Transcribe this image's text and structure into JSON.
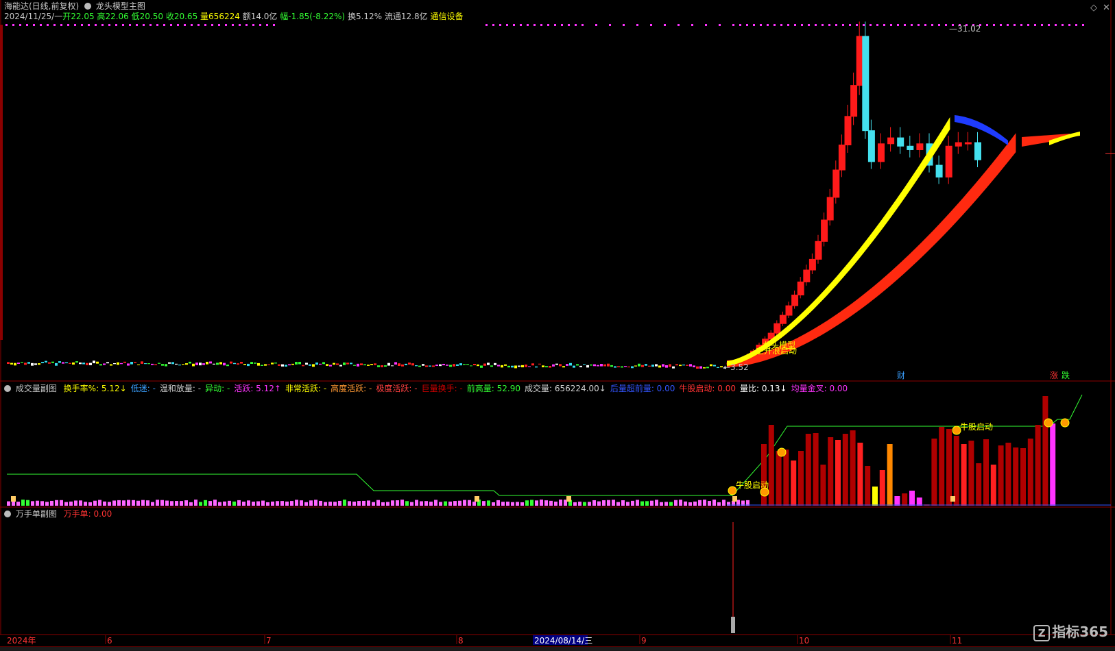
{
  "header": {
    "title": "海能达(日线,前复权)",
    "indicator": "龙头模型主图"
  },
  "info": {
    "date": "2024/11/25/一",
    "open_label": "开",
    "open": "22.05",
    "high_label": "高",
    "high": "22.06",
    "low_label": "低",
    "low": "20.50",
    "close_label": "收",
    "close": "20.65",
    "vol_label": "量",
    "vol": "656224",
    "amount": "额14.0亿",
    "change": "幅-1.85(-8.22%)",
    "turnover": "换5.12%",
    "float": "流通12.8亿",
    "sector": "通信设备"
  },
  "price_annot": {
    "max_label": "31.02",
    "min_label": "3.52",
    "tag_cai": "财",
    "tag_zhang": "涨",
    "tag_die": "跌",
    "signal1": "龙头模型",
    "signal2": "主升浪启动"
  },
  "vol_panel": {
    "title": "成交量副图",
    "items": [
      {
        "label": "换手率%:",
        "value": "5.12↓",
        "color": "#ffff00"
      },
      {
        "label": "低迷:",
        "value": "-",
        "color": "#3aa0ff"
      },
      {
        "label": "温和放量:",
        "value": "-",
        "color": "#d0d0d0"
      },
      {
        "label": "异动:",
        "value": "-",
        "color": "#33ff33"
      },
      {
        "label": "活跃:",
        "value": "5.12↑",
        "color": "#ff33ff"
      },
      {
        "label": "非常活跃:",
        "value": "-",
        "color": "#ffff00"
      },
      {
        "label": "高度活跃:",
        "value": "-",
        "color": "#ff9933"
      },
      {
        "label": "极度活跃:",
        "value": "-",
        "color": "#ff4040"
      },
      {
        "label": "巨量换手:",
        "value": "-",
        "color": "#cc0000"
      },
      {
        "label": "前高量:",
        "value": "52.90",
        "color": "#33ff33"
      },
      {
        "label": "成交量:",
        "value": "656224.00↓",
        "color": "#d0d0d0"
      },
      {
        "label": "后量超前量:",
        "value": "0.00",
        "color": "#3355ff"
      },
      {
        "label": "牛股启动:",
        "value": "0.00",
        "color": "#ff3333"
      },
      {
        "label": "量比:",
        "value": "0.13↓",
        "color": "#ffffff"
      },
      {
        "label": "均量金叉:",
        "value": "0.00",
        "color": "#ff33ff"
      }
    ],
    "signal_label": "牛股启动"
  },
  "wan_panel": {
    "title": "万手单副图",
    "label": "万手单:",
    "value": "0.00"
  },
  "dates": {
    "year": "2024年",
    "m6": "6",
    "m7": "7",
    "m8": "8",
    "m9": "9",
    "m10": "10",
    "m11": "11",
    "cursor": "2024/08/14/三"
  },
  "logo": {
    "text": "指标365",
    "glyph": "Z"
  },
  "chart_data": {
    "type": "candlestick",
    "title": "",
    "ylim": [
      3.0,
      32.0
    ],
    "max_close_marker": 31.02,
    "min_marker": 3.52,
    "series": [
      {
        "name": "",
        "values": [
          3.6,
          3.62,
          3.65,
          3.6,
          3.58,
          3.6,
          3.55,
          3.6,
          3.62,
          3.58,
          3.6,
          3.65,
          3.6,
          3.55,
          3.58,
          3.6,
          3.62,
          3.6,
          3.58,
          3.55,
          3.52,
          3.6,
          3.7,
          3.9,
          4.2,
          4.6,
          5.1,
          5.6,
          6.1,
          6.9,
          7.6,
          8.4,
          9.3,
          10.4,
          11.4,
          12.3,
          13.8,
          15.6,
          17.5,
          19.8,
          21.9,
          24.3,
          26.9,
          31.02,
          23.1,
          20.5,
          22.0,
          22.5,
          21.8,
          21.5,
          22.0,
          20.2,
          19.2,
          21.8,
          22.1,
          22.1,
          20.65
        ]
      }
    ]
  }
}
